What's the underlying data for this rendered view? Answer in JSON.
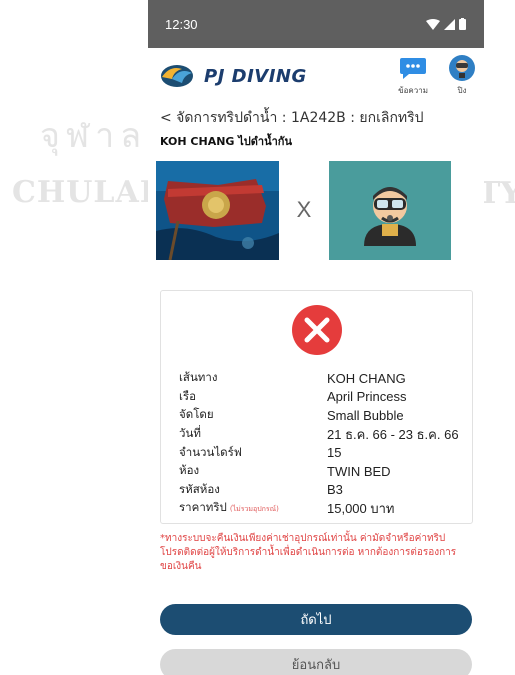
{
  "status_bar": {
    "time": "12:30"
  },
  "app": {
    "logo_text": "PJ DIVING",
    "messages_label": "ข้อความ",
    "profile_label": "ปิง"
  },
  "breadcrumb": "< จัดการทริปดำน้ำ : 1A242B : ยกเลิกทริป",
  "trip_title": "KOH CHANG ไปดำน้ำกัน",
  "hero": {
    "separator": "X"
  },
  "details": [
    {
      "label": "เส้นทาง",
      "value": "KOH CHANG"
    },
    {
      "label": "เรือ",
      "value": "April Princess"
    },
    {
      "label": "จัดโดย",
      "value": "Small Bubble"
    },
    {
      "label": "วันที่",
      "value": "21 ธ.ค. 66 - 23 ธ.ค. 66"
    },
    {
      "label": "จำนวนไดร์ฟ",
      "value": "15"
    },
    {
      "label": "ห้อง",
      "value": "TWIN BED"
    },
    {
      "label": "รหัสห้อง",
      "value": "B3"
    },
    {
      "label": "ราคาทริป",
      "sub_label": "(ไม่รวมอุปกรณ์)",
      "value": "15,000 บาท"
    }
  ],
  "notice": "*ทางระบบจะคืนเงินเพียงค่าเช่าอุปกรณ์เท่านั้น ค่ามัดจำหรือค่าทริป โปรดติดต่อผู้ให้บริการดำน้ำเพื่อดำเนินการต่อ หากต้องการต่อรองการขอเงินคืน",
  "buttons": {
    "next": "ถัดไป",
    "back": "ย้อนกลับ"
  },
  "colors": {
    "primary": "#1c4d72",
    "danger": "#e53c3c",
    "status_bar": "#5f5f5f",
    "diver_bg": "#4a9c9c"
  }
}
